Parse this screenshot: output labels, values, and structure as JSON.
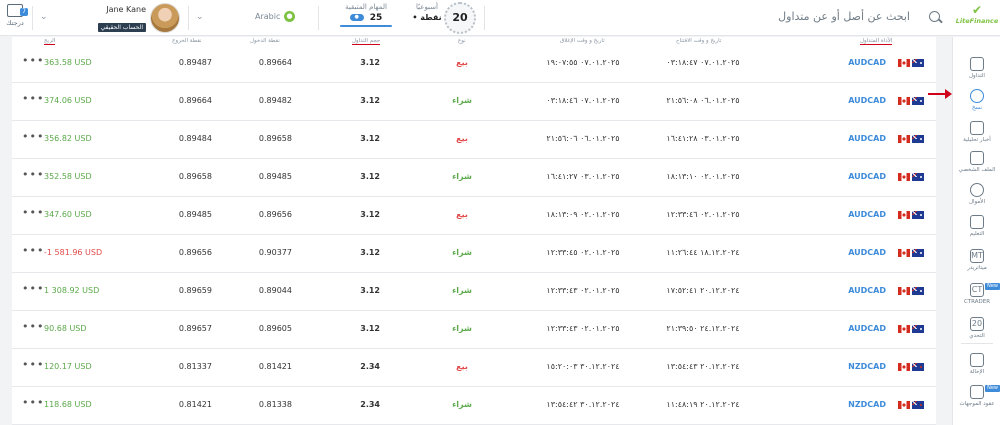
{
  "header": {
    "notifications_label": "درجتك",
    "notifications_count": "7",
    "user_name": "Jane Kane",
    "account_type": "الحساب الحقيقي",
    "language": "Arabic",
    "tasks_label": "المهام المتبقية",
    "tasks_value": "25",
    "week_label": "أسبوعيًا",
    "week_value": "• نقطة",
    "badge_value": "20",
    "search_placeholder": "ابحث عن أصل أو عن متداول",
    "logo_text": "LiteFinance"
  },
  "sidebar": {
    "items": [
      {
        "label": "التداول",
        "icon": "trading-icon"
      },
      {
        "label": "نسخ",
        "icon": "copy-icon",
        "active": true
      },
      {
        "label": "أخبار تحليلية",
        "icon": "news-icon"
      },
      {
        "label": "الملف الشخصي",
        "icon": "profile-icon"
      },
      {
        "label": "الأموال",
        "icon": "money-icon"
      },
      {
        "label": "التعليم",
        "icon": "education-icon"
      },
      {
        "label": "ميتاتريدر",
        "icon": "metatrader-icon",
        "glyph": "MT"
      },
      {
        "label": "CTRADER",
        "icon": "ctrader-icon",
        "glyph": "CT",
        "new": "New"
      },
      {
        "label": "التحدي",
        "icon": "challenge-icon",
        "glyph": "20"
      },
      {
        "label": "الإحالة",
        "icon": "referral-icon"
      },
      {
        "label": "عقود الموجهات",
        "icon": "contracts-icon",
        "new": "New"
      }
    ]
  },
  "table": {
    "headers": {
      "profit": "الربح",
      "close_price": "نقطة الخروج",
      "open_price": "نقطة الدخول",
      "volume": "حجم التداول",
      "type": "نوع",
      "close_time": "تاريخ و وقت الإغلاق",
      "open_time": "تاريخ و وقت الافتتاح",
      "instrument": "الأداة المتداول"
    },
    "rows": [
      {
        "profit": "363.58 USD",
        "profit_sign": "pos",
        "close": "0.89487",
        "open": "0.89664",
        "volume": "3.12",
        "type": "بيع",
        "type_class": "sell",
        "close_time": "٠٧.٠١.٢٠٢٥ ١٩:٠٧:٥٥",
        "open_time": "٠٧.٠١.٢٠٢٥ ٠٣:١٨:٤٧",
        "instrument": "AUDCAD",
        "flag": "au"
      },
      {
        "profit": "374.06 USD",
        "profit_sign": "pos",
        "close": "0.89664",
        "open": "0.89482",
        "volume": "3.12",
        "type": "شراء",
        "type_class": "buy",
        "close_time": "٠٧.٠١.٢٠٢٥ ٠٣:١٨:٤٦",
        "open_time": "٠٦.٠١.٢٠٢٥ ٢١:٥٦:٠٨",
        "instrument": "AUDCAD",
        "flag": "au"
      },
      {
        "profit": "356.82 USD",
        "profit_sign": "pos",
        "close": "0.89484",
        "open": "0.89658",
        "volume": "3.12",
        "type": "بيع",
        "type_class": "sell",
        "close_time": "٠٦.٠١.٢٠٢٥ ٢١:٥٦:٠٦",
        "open_time": "٠٣.٠١.٢٠٢٥ ١٦:٤١:٢٨",
        "instrument": "AUDCAD",
        "flag": "au"
      },
      {
        "profit": "352.58 USD",
        "profit_sign": "pos",
        "close": "0.89658",
        "open": "0.89485",
        "volume": "3.12",
        "type": "شراء",
        "type_class": "buy",
        "close_time": "٠٣.٠١.٢٠٢٥ ١٦:٤١:٢٧",
        "open_time": "٠٢.٠١.٢٠٢٥ ١٨:١٣:١٠",
        "instrument": "AUDCAD",
        "flag": "au"
      },
      {
        "profit": "347.60 USD",
        "profit_sign": "pos",
        "close": "0.89485",
        "open": "0.89656",
        "volume": "3.12",
        "type": "بيع",
        "type_class": "sell",
        "close_time": "٠٢.٠١.٢٠٢٥ ١٨:١٣:٠٩",
        "open_time": "٠٢.٠١.٢٠٢٥ ١٢:٣٣:٤٦",
        "instrument": "AUDCAD",
        "flag": "au"
      },
      {
        "profit": "-1 581.96 USD",
        "profit_sign": "neg",
        "close": "0.89656",
        "open": "0.90377",
        "volume": "3.12",
        "type": "شراء",
        "type_class": "buy",
        "close_time": "٠٢.٠١.٢٠٢٥ ١٢:٣٣:٤٥",
        "open_time": "١٨.١٢.٢٠٢٤ ١١:٢٦:٤٤",
        "instrument": "AUDCAD",
        "flag": "au"
      },
      {
        "profit": "1 308.92 USD",
        "profit_sign": "pos",
        "close": "0.89659",
        "open": "0.89044",
        "volume": "3.12",
        "type": "شراء",
        "type_class": "buy",
        "close_time": "٠٢.٠١.٢٠٢٥ ١٢:٣٣:٤٣",
        "open_time": "٢٠.١٢.٢٠٢٤ ١٧:٥٢:٤١",
        "instrument": "AUDCAD",
        "flag": "au"
      },
      {
        "profit": "90.68 USD",
        "profit_sign": "pos",
        "close": "0.89657",
        "open": "0.89605",
        "volume": "3.12",
        "type": "شراء",
        "type_class": "buy",
        "close_time": "٠٢.٠١.٢٠٢٥ ١٢:٣٣:٤٣",
        "open_time": "٢٤.١٢.٢٠٢٤ ٢١:٣٩:٥٠",
        "instrument": "AUDCAD",
        "flag": "au"
      },
      {
        "profit": "120.17 USD",
        "profit_sign": "pos",
        "close": "0.81337",
        "open": "0.81421",
        "volume": "2.34",
        "type": "بيع",
        "type_class": "sell",
        "close_time": "٣٠.١٢.٢٠٢٤ ١٥:٢٠:٠٣",
        "open_time": "٢٠.١٢.٢٠٢٤ ١٣:٥٤:٤٣",
        "instrument": "NZDCAD",
        "flag": "nz"
      },
      {
        "profit": "118.68 USD",
        "profit_sign": "pos",
        "close": "0.81421",
        "open": "0.81338",
        "volume": "2.34",
        "type": "شراء",
        "type_class": "buy",
        "close_time": "٣٠.١٢.٢٠٢٤ ١٣:٥٤:٤٢",
        "open_time": "٢٠.١٢.٢٠٢٤ ١١:٤٨:١٩",
        "instrument": "NZDCAD",
        "flag": "nz"
      }
    ]
  }
}
